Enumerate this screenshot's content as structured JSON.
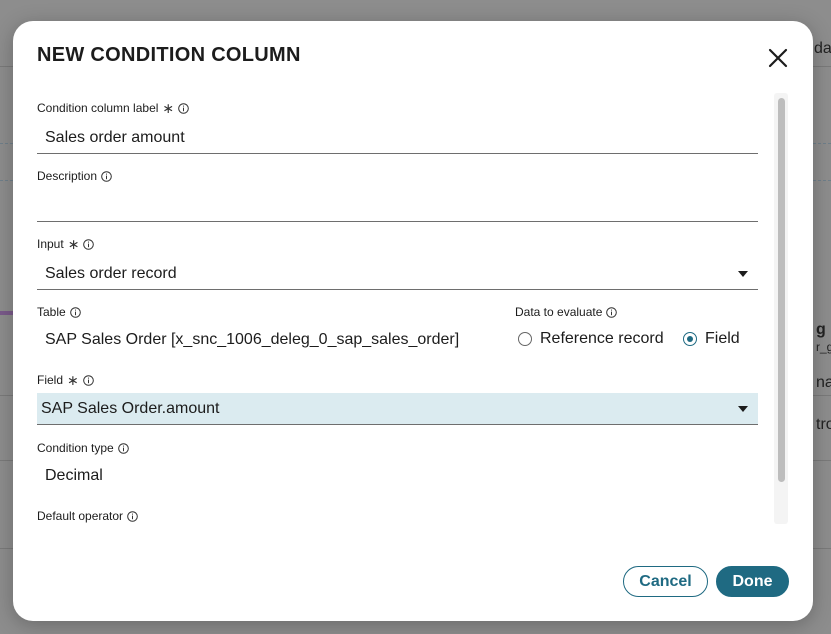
{
  "background": {
    "right_texts": [
      "da",
      "g",
      "r_g",
      "na",
      "tro"
    ]
  },
  "modal": {
    "title": "NEW CONDITION COLUMN",
    "close_icon": "close-icon",
    "fields": {
      "condition_label": {
        "label": "Condition column label",
        "required": "∗",
        "value": "Sales order amount"
      },
      "description": {
        "label": "Description",
        "value": ""
      },
      "input": {
        "label": "Input",
        "required": "∗",
        "value": "Sales order record"
      },
      "table": {
        "label": "Table",
        "value": "SAP Sales Order [x_snc_1006_deleg_0_sap_sales_order]"
      },
      "data_to_evaluate": {
        "label": "Data to evaluate",
        "options": [
          "Reference record",
          "Field"
        ],
        "selected": "Field"
      },
      "field": {
        "label": "Field",
        "required": "∗",
        "value": "SAP Sales Order.amount"
      },
      "condition_type": {
        "label": "Condition type",
        "value": "Decimal"
      },
      "default_operator": {
        "label": "Default operator"
      }
    },
    "buttons": {
      "cancel": "Cancel",
      "done": "Done"
    },
    "accent_color": "#1f6a82",
    "highlight_color": "#dbebf0"
  }
}
